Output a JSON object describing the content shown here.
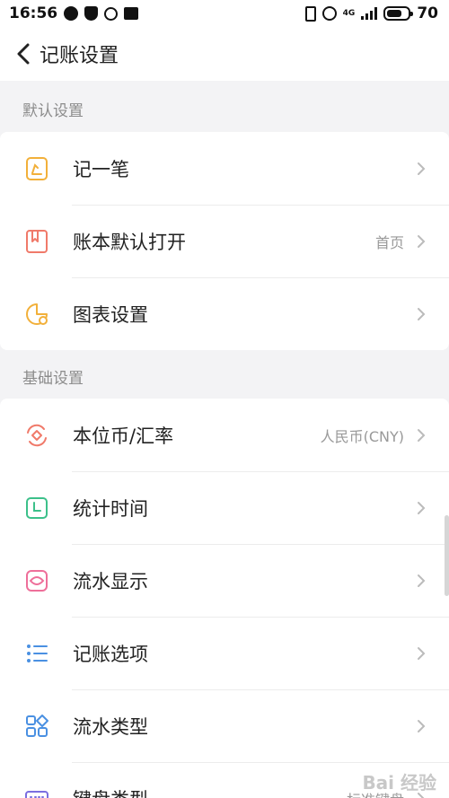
{
  "status_bar": {
    "time": "16:56",
    "battery": "70",
    "battery_level_percent": 70,
    "network": "4G"
  },
  "header": {
    "title": "记账设置"
  },
  "sections": [
    {
      "title": "默认设置",
      "items": [
        {
          "label": "记一笔",
          "value": "",
          "icon": "pen-note-icon",
          "color": "#f2b03a"
        },
        {
          "label": "账本默认打开",
          "value": "首页",
          "icon": "book-icon",
          "color": "#f07a6a"
        },
        {
          "label": "图表设置",
          "value": "",
          "icon": "pie-chart-icon",
          "color": "#f2b03a"
        }
      ]
    },
    {
      "title": "基础设置",
      "items": [
        {
          "label": "本位币/汇率",
          "value": "人民币(CNY)",
          "icon": "currency-exchange-icon",
          "color": "#f07a6a"
        },
        {
          "label": "统计时间",
          "value": "",
          "icon": "clock-square-icon",
          "color": "#3cc08a"
        },
        {
          "label": "流水显示",
          "value": "",
          "icon": "eye-display-icon",
          "color": "#ee6f9a"
        },
        {
          "label": "记账选项",
          "value": "",
          "icon": "list-options-icon",
          "color": "#4a90e2"
        },
        {
          "label": "流水类型",
          "value": "",
          "icon": "grid-types-icon",
          "color": "#4a90e2"
        },
        {
          "label": "键盘类型",
          "value": "标准键盘",
          "icon": "keyboard-icon",
          "color": "#7a6ee0"
        }
      ]
    }
  ],
  "watermark": "Bai 经验"
}
